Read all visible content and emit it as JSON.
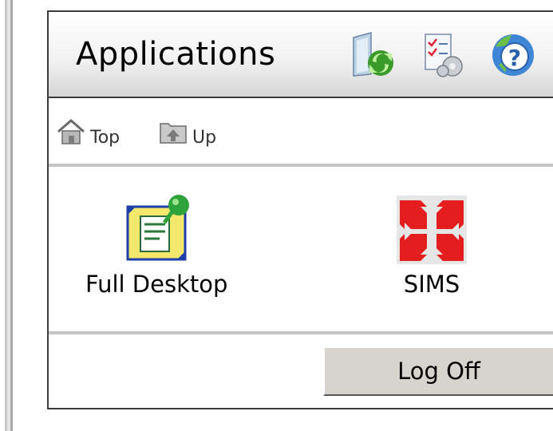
{
  "header": {
    "title": "Applications",
    "icons": [
      "refresh-icon",
      "preferences-icon",
      "help-icon"
    ]
  },
  "nav": {
    "top_label": "Top",
    "up_label": "Up"
  },
  "apps": [
    {
      "label": "Full Desktop",
      "icon": "full-desktop-icon"
    },
    {
      "label": "SIMS",
      "icon": "sims-icon"
    }
  ],
  "footer": {
    "logoff_label": "Log Off"
  },
  "colors": {
    "border": "#3c3c3c",
    "separator": "#c4c4c4",
    "button_face": "#d7d3cd",
    "sims_red": "#e41e1e"
  }
}
